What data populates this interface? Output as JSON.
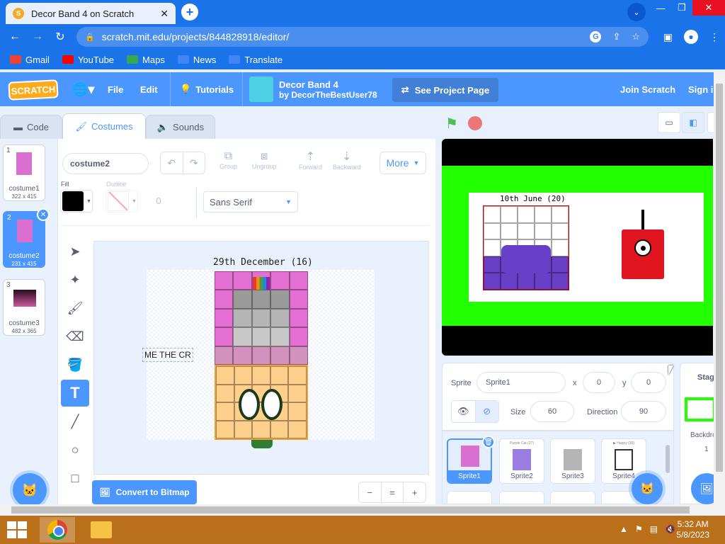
{
  "browser": {
    "tab_title": "Decor Band 4 on Scratch",
    "tab_close": "✕",
    "new_tab": "+",
    "tab_dropdown": "⌄",
    "url": "scratch.mit.edu/projects/844828918/editor/",
    "bookmarks": [
      {
        "label": "Gmail",
        "color": "#ea4335"
      },
      {
        "label": "YouTube",
        "color": "#ff0000"
      },
      {
        "label": "Maps",
        "color": "#34a853"
      },
      {
        "label": "News",
        "color": "#4285f4"
      },
      {
        "label": "Translate",
        "color": "#4285f4"
      }
    ]
  },
  "menubar": {
    "logo": "SCRATCH",
    "file": "File",
    "edit": "Edit",
    "tutorials": "Tutorials",
    "project_title": "Decor Band 4",
    "project_author": "by DecorTheBestUser78",
    "see_project": "See Project Page",
    "join": "Join Scratch",
    "signin": "Sign in"
  },
  "tabs": {
    "code": "Code",
    "costumes": "Costumes",
    "sounds": "Sounds"
  },
  "costumes": [
    {
      "num": "1",
      "name": "costume1",
      "size": "322 x 415",
      "color": "#d96fd0"
    },
    {
      "num": "2",
      "name": "costume2",
      "size": "231 x 415",
      "color": "#d96fd0"
    },
    {
      "num": "3",
      "name": "costume3",
      "size": "482 x 365",
      "color": "#6e1f4e"
    }
  ],
  "paint": {
    "costume_name": "costume2",
    "group": "Group",
    "ungroup": "Ungroup",
    "forward": "Forward",
    "backward": "Backward",
    "more": "More",
    "fill_label": "Fill",
    "outline_label": "Outline",
    "outline_width": "0",
    "font": "Sans Serif",
    "canvas_title": "29th December (16)",
    "canvas_text": "ME THE CR",
    "convert": "Convert to Bitmap",
    "zoom_out": "−",
    "zoom_reset": "=",
    "zoom_in": "+",
    "fill_color": "#000000"
  },
  "stage": {
    "title": "10th June (20)"
  },
  "sprite_info": {
    "sprite_label": "Sprite",
    "sprite_name": "Sprite1",
    "x_label": "x",
    "x_value": "0",
    "y_label": "y",
    "y_value": "0",
    "size_label": "Size",
    "size_value": "60",
    "direction_label": "Direction",
    "direction_value": "90"
  },
  "sprites": [
    {
      "name": "Sprite1",
      "caption": ""
    },
    {
      "name": "Sprite2",
      "caption": "Purple Cat (27)"
    },
    {
      "name": "Sprite3",
      "caption": ""
    },
    {
      "name": "Sprite4",
      "caption": "▶ Happy (30)"
    }
  ],
  "stage_panel": {
    "label": "Stage",
    "backdrops_label": "Backdrops",
    "backdrops_count": "1"
  },
  "taskbar": {
    "time": "5:32 AM",
    "date": "5/8/2023"
  }
}
